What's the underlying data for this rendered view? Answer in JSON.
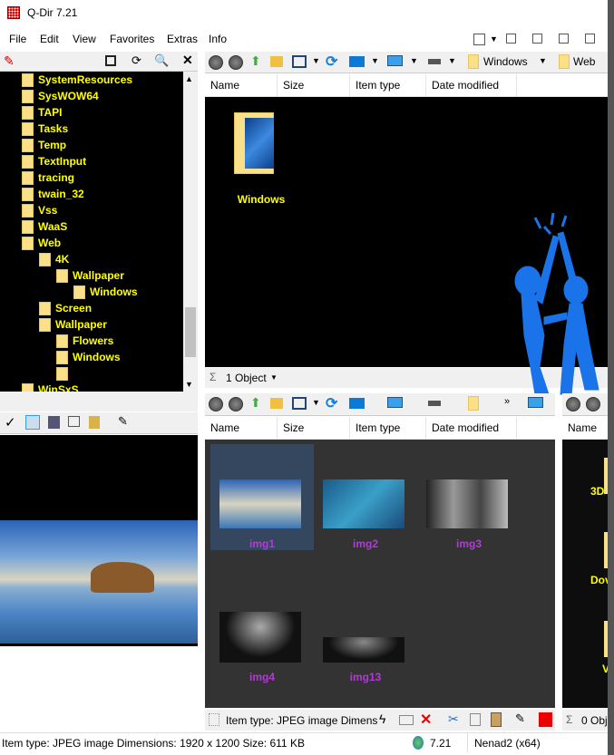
{
  "window": {
    "title": "Q-Dir 7.21"
  },
  "menu": [
    "File",
    "Edit",
    "View",
    "Favorites",
    "Extras",
    "Info"
  ],
  "tree": {
    "items": [
      {
        "label": "SystemResources",
        "level": 0
      },
      {
        "label": "SysWOW64",
        "level": 0
      },
      {
        "label": "TAPI",
        "level": 0
      },
      {
        "label": "Tasks",
        "level": 0
      },
      {
        "label": "Temp",
        "level": 0
      },
      {
        "label": "TextInput",
        "level": 0
      },
      {
        "label": "tracing",
        "level": 0
      },
      {
        "label": "twain_32",
        "level": 0
      },
      {
        "label": "Vss",
        "level": 0
      },
      {
        "label": "WaaS",
        "level": 0
      },
      {
        "label": "Web",
        "level": 0
      },
      {
        "label": "4K",
        "level": 1
      },
      {
        "label": "Wallpaper",
        "level": 2
      },
      {
        "label": "Windows",
        "level": 3
      },
      {
        "label": "Screen",
        "level": 1
      },
      {
        "label": "Wallpaper",
        "level": 1
      },
      {
        "label": "Flowers",
        "level": 2
      },
      {
        "label": "Windows",
        "level": 2
      },
      {
        "label": "",
        "level": 2
      },
      {
        "label": "WinSxS",
        "level": 0
      }
    ]
  },
  "columns": [
    "Name",
    "Size",
    "Item type",
    "Date modified"
  ],
  "pane1": {
    "address": [
      "Windows",
      "Web"
    ],
    "items": [
      "Windows"
    ],
    "status": "1 Object"
  },
  "pane2": {
    "items": [
      "img1",
      "img2",
      "img3",
      "img4",
      "img13"
    ],
    "status": "Item type: JPEG image Dimens"
  },
  "pane3": {
    "column": "Name",
    "items": [
      "3D",
      "Dov",
      "V"
    ],
    "status": "0 Obj"
  },
  "statusbar": {
    "info": "Item type: JPEG image Dimensions: 1920 x 1200 Size: 611 KB",
    "version": "7.21",
    "user": "Nenad2 (x64)"
  },
  "colors": {
    "tree_text": "#ffff00",
    "thumb_label": "#b03bd6",
    "selection": "#34475e"
  }
}
